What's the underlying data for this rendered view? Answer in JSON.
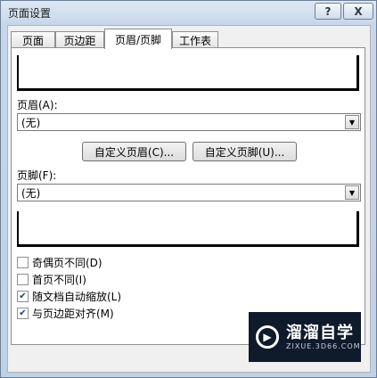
{
  "window": {
    "title": "页面设置",
    "help_label": "?",
    "close_label": "X"
  },
  "tabs": [
    {
      "label": "页面"
    },
    {
      "label": "页边距"
    },
    {
      "label": "页眉/页脚"
    },
    {
      "label": "工作表"
    }
  ],
  "header": {
    "label": "页眉(A):",
    "value": "(无)"
  },
  "buttons": {
    "custom_header": "自定义页眉(C)...",
    "custom_footer": "自定义页脚(U)..."
  },
  "footer": {
    "label": "页脚(F):",
    "value": "(无)"
  },
  "options": [
    {
      "label": "奇偶页不同(D)",
      "checked": false
    },
    {
      "label": "首页不同(I)",
      "checked": false
    },
    {
      "label": "随文档自动缩放(L)",
      "checked": true
    },
    {
      "label": "与页边距对齐(M)",
      "checked": true
    }
  ],
  "icons": {
    "dropdown": "chevron-down-icon",
    "check": "checkmark-icon"
  },
  "watermark": {
    "brand": "溜溜自学",
    "site": "ZIXUE.3D66.COM"
  }
}
